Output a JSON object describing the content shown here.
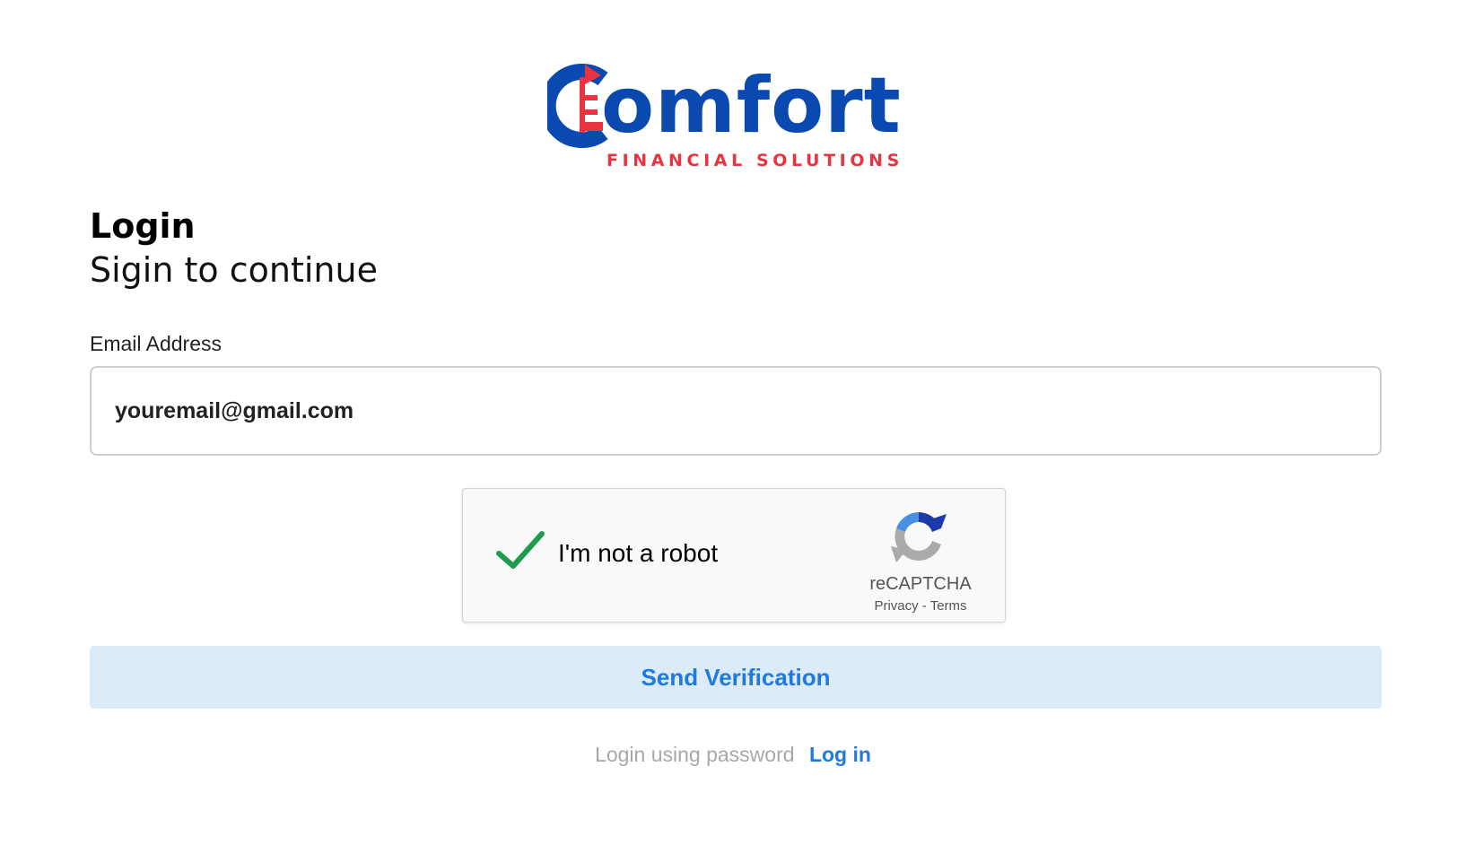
{
  "brand": {
    "name": "omfort",
    "tagline": "FINANCIAL SOLUTIONS",
    "primary_color": "#0a4ab0",
    "accent_color": "#e8343f",
    "logo_icon": "comfort-c-logo-icon"
  },
  "heading": {
    "title": "Login",
    "subtitle": "Sigin to continue"
  },
  "form": {
    "email_label": "Email Address",
    "email_value": "youremail@gmail.com"
  },
  "captcha": {
    "label": "I'm not a robot",
    "brand": "reCAPTCHA",
    "privacy": "Privacy",
    "separator": "-",
    "terms": "Terms",
    "checked": true,
    "check_icon": "checkmark-icon",
    "logo_icon": "recaptcha-icon"
  },
  "actions": {
    "send_label": "Send Verification",
    "button_bg": "#dcebfa",
    "button_text_color": "#1f7ae0"
  },
  "footer": {
    "text": "Login using password",
    "link": "Log in"
  }
}
